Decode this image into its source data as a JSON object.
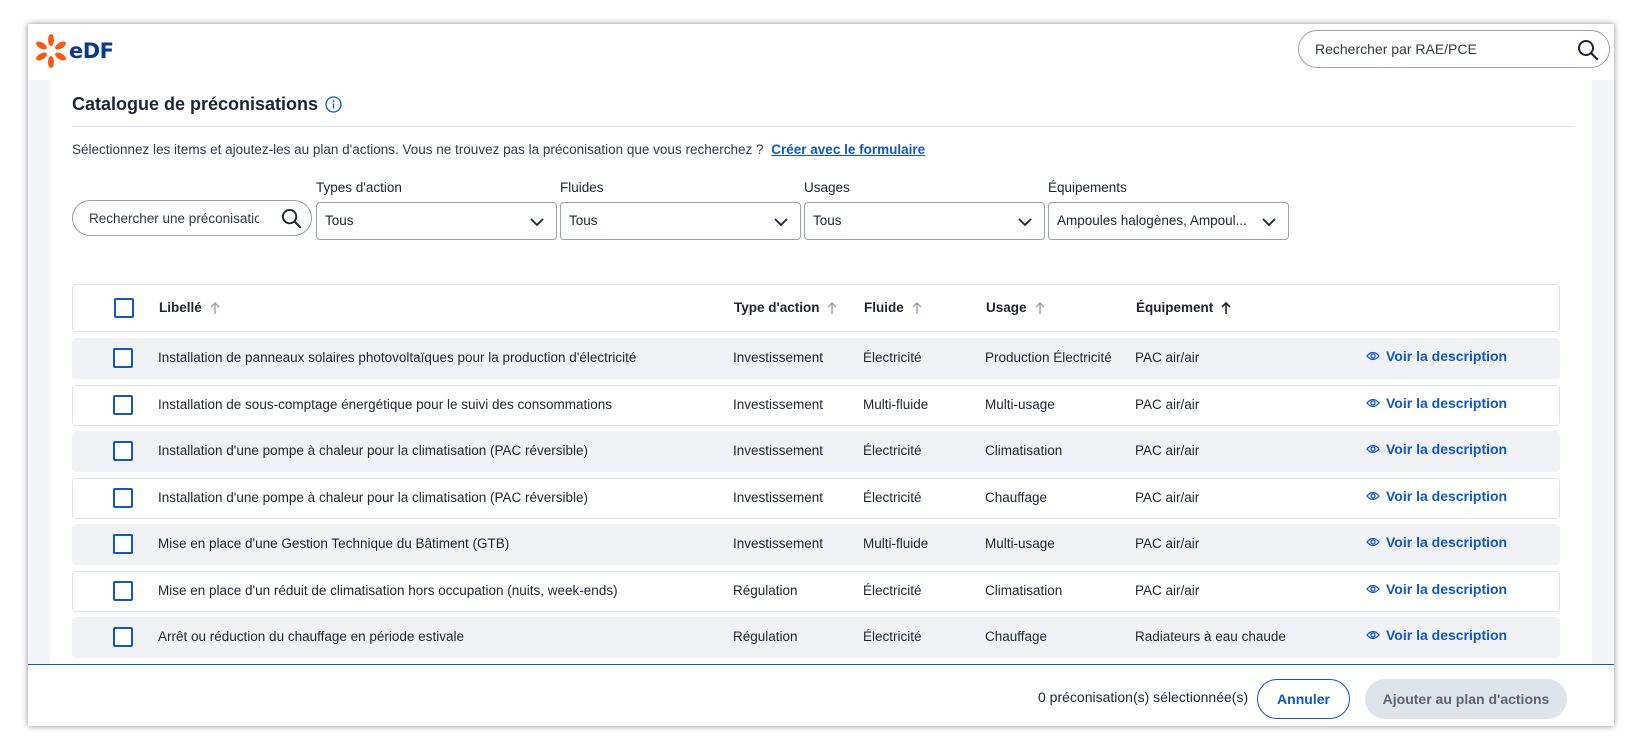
{
  "brand": {
    "logo_text": "eDF"
  },
  "header": {
    "search_placeholder": "Rechercher par RAE/PCE"
  },
  "catalog": {
    "title": "Catalogue de préconisations",
    "intro_text": "Sélectionnez les items et ajoutez-les au plan d'actions. Vous ne trouvez pas la préconisation que vous recherchez ?",
    "intro_link": "Créer avec le formulaire"
  },
  "filters": {
    "search_placeholder": "Rechercher une préconisation",
    "action_types": {
      "label": "Types d'action",
      "value": "Tous"
    },
    "fluids": {
      "label": "Fluides",
      "value": "Tous"
    },
    "usages": {
      "label": "Usages",
      "value": "Tous"
    },
    "equipments": {
      "label": "Équipements",
      "value": "Ampoules halogènes, Ampoul..."
    }
  },
  "table": {
    "columns": {
      "label": "Libellé",
      "action_type": "Type d'action",
      "fluid": "Fluide",
      "usage": "Usage",
      "equipment": "Équipement"
    },
    "link_label": "Voir la description",
    "rows": [
      {
        "label": "Installation de panneaux solaires photovoltaïques pour la production d'électricité",
        "action_type": "Investissement",
        "fluid": "Électricité",
        "usage": "Production Électricité",
        "equipment": "PAC air/air"
      },
      {
        "label": "Installation de sous-comptage énergétique pour le suivi des consommations",
        "action_type": "Investissement",
        "fluid": "Multi-fluide",
        "usage": "Multi-usage",
        "equipment": "PAC air/air"
      },
      {
        "label": "Installation d'une pompe à chaleur pour la climatisation (PAC réversible)",
        "action_type": "Investissement",
        "fluid": "Électricité",
        "usage": "Climatisation",
        "equipment": "PAC air/air"
      },
      {
        "label": "Installation d'une pompe à chaleur pour la climatisation (PAC réversible)",
        "action_type": "Investissement",
        "fluid": "Électricité",
        "usage": "Chauffage",
        "equipment": "PAC air/air"
      },
      {
        "label": "Mise en place d'une Gestion Technique du Bâtiment (GTB)",
        "action_type": "Investissement",
        "fluid": "Multi-fluide",
        "usage": "Multi-usage",
        "equipment": "PAC air/air"
      },
      {
        "label": "Mise en place d'un réduit de climatisation hors occupation (nuits, week-ends)",
        "action_type": "Régulation",
        "fluid": "Électricité",
        "usage": "Climatisation",
        "equipment": "PAC air/air"
      },
      {
        "label": "Arrêt ou réduction du chauffage en période estivale",
        "action_type": "Régulation",
        "fluid": "Électricité",
        "usage": "Chauffage",
        "equipment": "Radiateurs à eau chaude"
      }
    ]
  },
  "footer": {
    "selected_count": "0 préconisation(s) sélectionnée(s)",
    "cancel_label": "Annuler",
    "add_label": "Ajouter au plan d'actions"
  },
  "colors": {
    "accent": "#1057c8",
    "brand_orange": "#fe5815",
    "brand_navy": "#0a3a8c"
  }
}
